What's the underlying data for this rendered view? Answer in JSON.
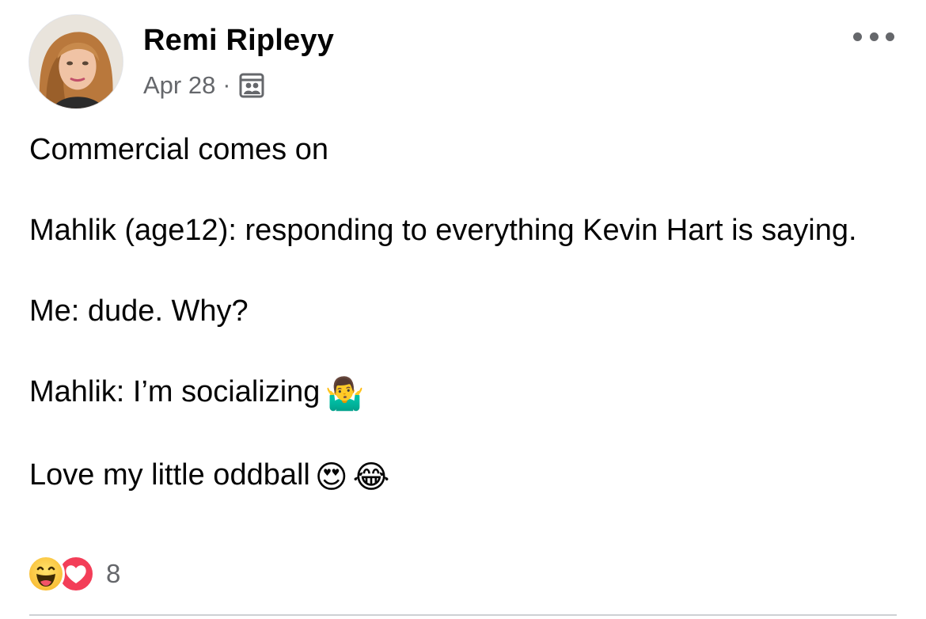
{
  "post": {
    "author": "Remi Ripleyy",
    "date": "Apr 28",
    "separator": "·",
    "audience_icon": "custom-audience-icon",
    "more_icon": "more-options-icon",
    "lines": [
      "Commercial comes on",
      "Mahlik (age12): responding to everything Kevin Hart is saying.",
      "Me: dude. Why?",
      "Mahlik: I’m socializing",
      "Love my little oddball"
    ],
    "emojis": {
      "shrug": "🤷‍♂️",
      "heart_eyes": "😍",
      "tears_of_joy": "😂"
    },
    "reactions": {
      "types": [
        "haha",
        "love"
      ],
      "count": "8"
    }
  }
}
